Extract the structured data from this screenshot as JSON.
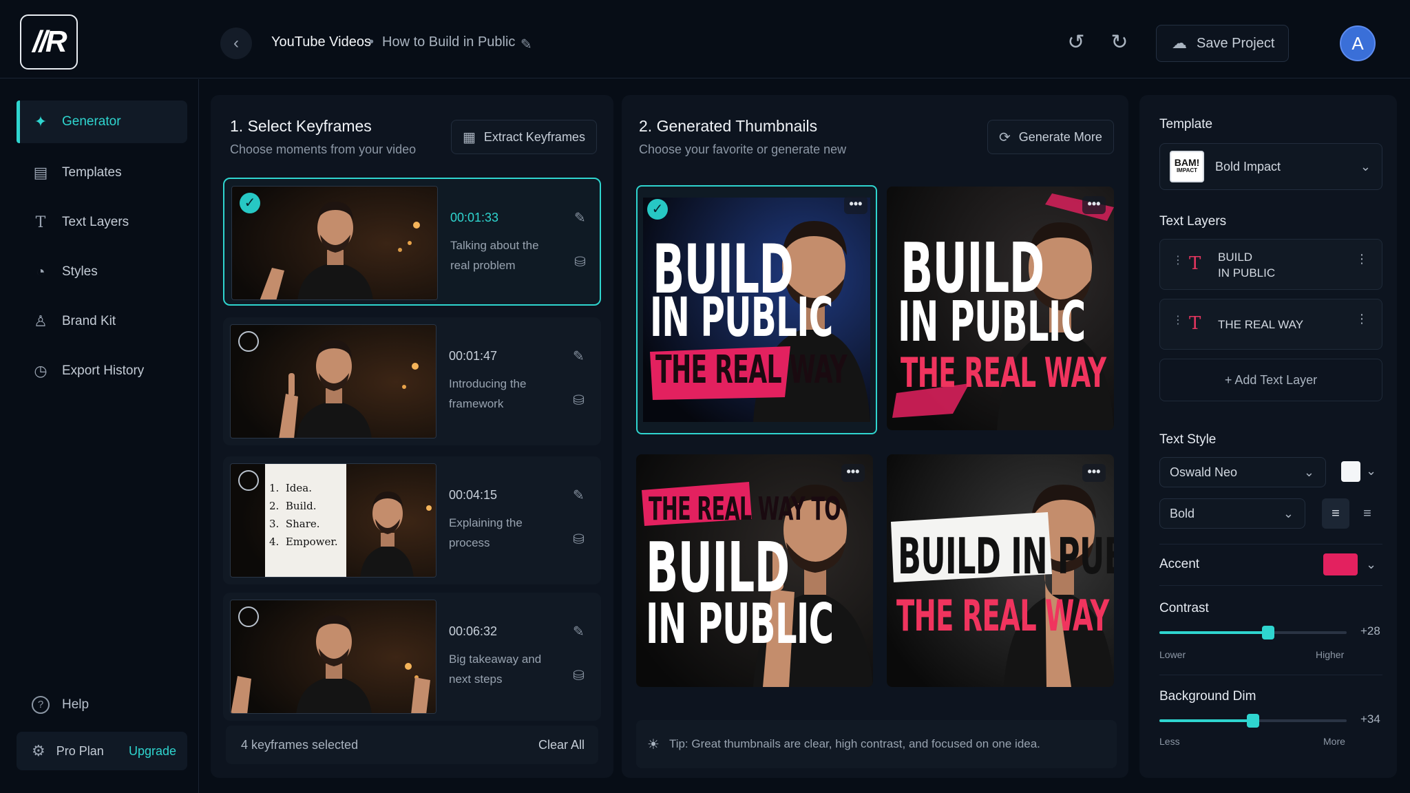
{
  "topbar": {
    "logo": "//R",
    "breadcrumb_root": "YouTube Videos",
    "breadcrumb_sep": "•",
    "breadcrumb_page": "How to Build in Public",
    "save_label": "Save Project",
    "avatar_letter": "A"
  },
  "sidebar": {
    "items": [
      {
        "label": "Generator",
        "icon": "sparkle-icon",
        "active": true
      },
      {
        "label": "Templates",
        "icon": "template-icon"
      },
      {
        "label": "Text Layers",
        "icon": "text-icon"
      },
      {
        "label": "Styles",
        "icon": "palette-icon"
      },
      {
        "label": "Brand Kit",
        "icon": "brand-icon"
      },
      {
        "label": "Export History",
        "icon": "history-icon"
      }
    ],
    "help_label": "Help",
    "plan_label": "Pro Plan",
    "upgrade_label": "Upgrade"
  },
  "keyframes": {
    "title": "1. Select Keyframes",
    "subtitle": "Choose moments from your video",
    "extract_label": "Extract Keyframes",
    "items": [
      {
        "time": "00:01:33",
        "desc": "Talking about the real problem",
        "selected": true
      },
      {
        "time": "00:01:47",
        "desc": "Introducing the framework",
        "selected": false
      },
      {
        "time": "00:04:15",
        "desc": "Explaining the process",
        "selected": false,
        "note": [
          "1.",
          "Idea.",
          "2.",
          "Build.",
          "3.",
          "Share.",
          "4.",
          "Empower."
        ]
      },
      {
        "time": "00:06:32",
        "desc": "Big takeaway and next steps",
        "selected": false
      }
    ],
    "footer_count": "4 keyframes selected",
    "clear_label": "Clear All"
  },
  "thumbnails": {
    "title": "2. Generated Thumbnails",
    "subtitle": "Choose your favorite or generate new",
    "generate_label": "Generate More",
    "items": [
      {
        "lines": [
          "BUILD",
          "IN PUBLIC",
          "THE REAL WAY"
        ]
      },
      {
        "lines": [
          "BUILD",
          "IN PUBLIC",
          "THE REAL WAY"
        ]
      },
      {
        "lines": [
          "THE REAL WAY TO",
          "BUILD",
          "IN PUBLIC"
        ]
      },
      {
        "lines": [
          "BUILD IN PUBLIC",
          "THE REAL WAY"
        ]
      }
    ],
    "more_glyph": "•••",
    "tip": "Tip: Great thumbnails are clear, high contrast, and focused on one idea."
  },
  "rightpanel": {
    "template_label": "Template",
    "template_badge_top": "BAM!",
    "template_badge_bottom": "IMPACT",
    "template_value": "Bold Impact",
    "text_layers_label": "Text Layers",
    "layers": [
      {
        "line1": "BUILD",
        "line2": "IN PUBLIC"
      },
      {
        "line1": "THE REAL WAY",
        "line2": ""
      }
    ],
    "add_layer_label": "+  Add Text Layer",
    "text_style_label": "Text Style",
    "font_value": "Oswald Neo",
    "weight_value": "Bold",
    "accent_label": "Accent",
    "accent_color": "#e3215f",
    "contrast_label": "Contrast",
    "contrast_value": "+28",
    "contrast_low": "Lower",
    "contrast_high": "Higher",
    "contrast_level": 0.58,
    "dim_label": "Background Dim",
    "dim_value": "+34",
    "dim_low": "Less",
    "dim_high": "More",
    "dim_level": 0.5
  },
  "colors": {
    "accent_teal": "#2fd5cf",
    "accent_pink": "#e3215f",
    "background": "#070d16"
  }
}
